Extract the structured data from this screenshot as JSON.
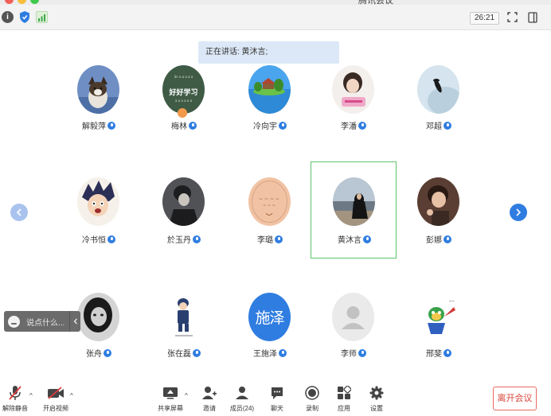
{
  "window": {
    "title": "腾讯会议"
  },
  "topbar": {
    "timer": "26:21"
  },
  "speaking": {
    "label": "正在讲话: 黄沐言;"
  },
  "participants": [
    {
      "name": "解毅萍"
    },
    {
      "name": "梅林"
    },
    {
      "name": "冷向宇"
    },
    {
      "name": "李潘"
    },
    {
      "name": "邓超"
    },
    {
      "name": "冷书恒"
    },
    {
      "name": "於玉丹"
    },
    {
      "name": "李璐"
    },
    {
      "name": "黄沐言"
    },
    {
      "name": "彭娜"
    },
    {
      "name": "张舟"
    },
    {
      "name": "张在磊"
    },
    {
      "name": "王施泽",
      "avatar_text": "施泽"
    },
    {
      "name": "李师"
    },
    {
      "name": "邢斐"
    }
  ],
  "avatar_texts": {
    "meilin": "好好学习"
  },
  "chat": {
    "placeholder": "说点什么..."
  },
  "toolbar": {
    "unmute": "解除静音",
    "start_video": "开启视频",
    "share_screen": "共享屏幕",
    "invite": "邀请",
    "members": "成员(24)",
    "chat": "聊天",
    "record": "录制",
    "apps": "应用",
    "settings": "设置",
    "leave": "离开会议"
  },
  "colors": {
    "accent": "#2f7de1",
    "active_border": "#5cc46a",
    "leave": "#d9443a"
  }
}
